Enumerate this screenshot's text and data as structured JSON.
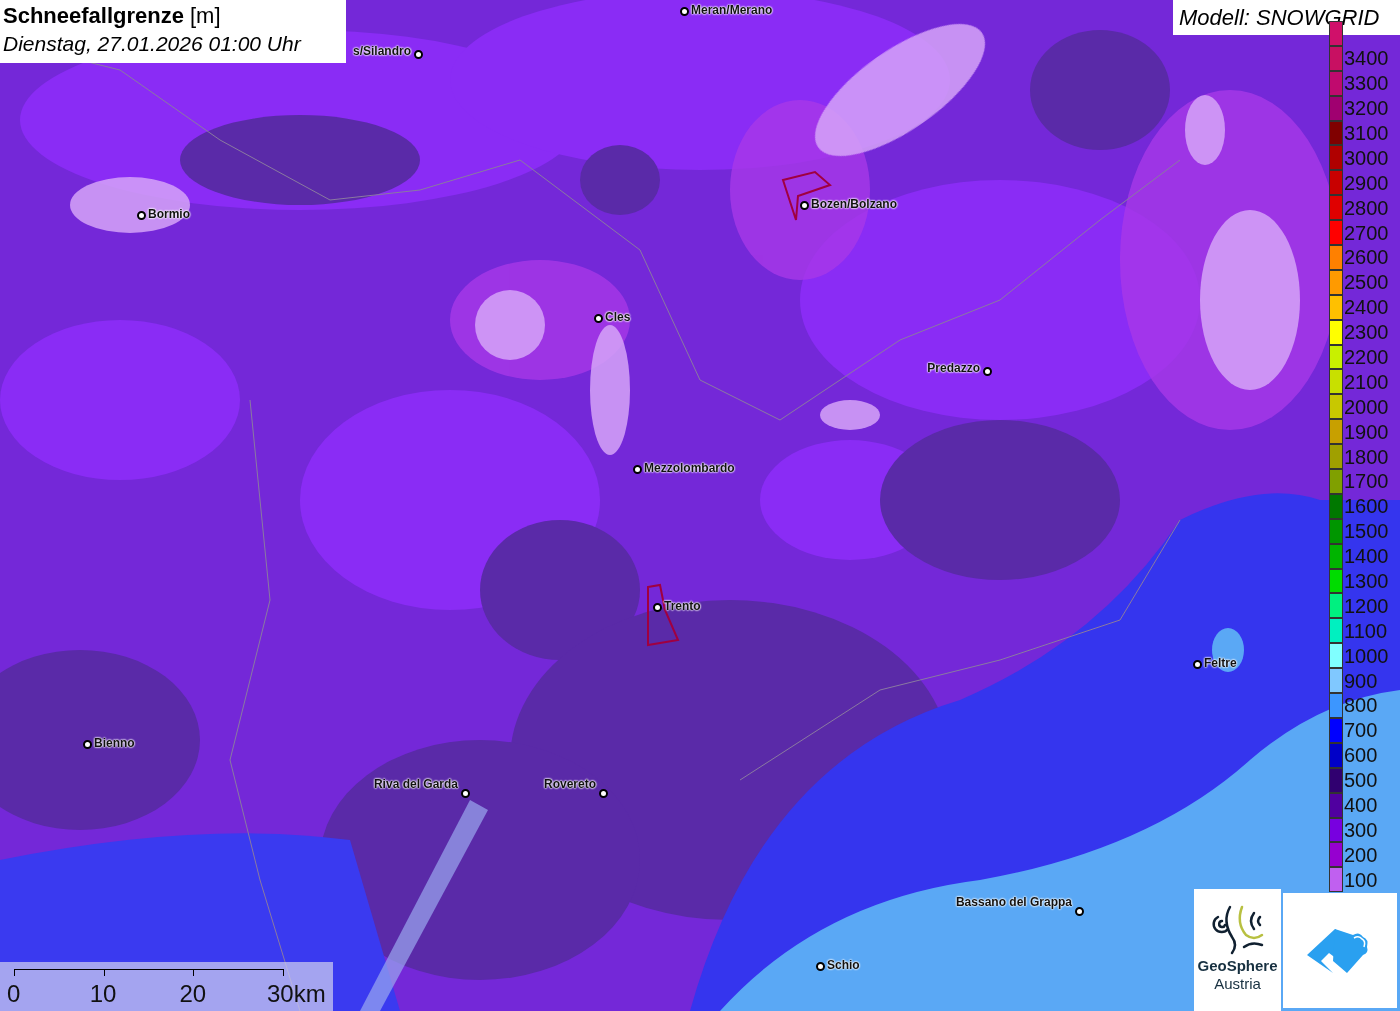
{
  "title": {
    "name": "Schneefallgrenze",
    "unit": "[m]",
    "datetime": "Dienstag, 27.01.2026 01:00 Uhr"
  },
  "model": "Modell: SNOWGRID",
  "places": [
    {
      "name": "Meran/Merano"
    },
    {
      "name": "s/Silandro"
    },
    {
      "name": "Bormio"
    },
    {
      "name": "Bozen/Bolzano"
    },
    {
      "name": "Cles"
    },
    {
      "name": "Predazzo"
    },
    {
      "name": "Mezzolombardo"
    },
    {
      "name": "Trento"
    },
    {
      "name": "Feltre"
    },
    {
      "name": "Bienno"
    },
    {
      "name": "Riva del Garda"
    },
    {
      "name": "Rovereto"
    },
    {
      "name": "Bassano del Grappa"
    },
    {
      "name": "Schio"
    }
  ],
  "legend": [
    {
      "color": "#d0106a"
    },
    {
      "label": "3400",
      "color": "#c81062"
    },
    {
      "label": "3300",
      "color": "#c00a6e"
    },
    {
      "label": "3200",
      "color": "#a00070"
    },
    {
      "label": "3100",
      "color": "#800000"
    },
    {
      "label": "3000",
      "color": "#b00000"
    },
    {
      "label": "2900",
      "color": "#c80000"
    },
    {
      "label": "2800",
      "color": "#e00000"
    },
    {
      "label": "2700",
      "color": "#ff0000"
    },
    {
      "label": "2600",
      "color": "#ff8000"
    },
    {
      "label": "2500",
      "color": "#ff9a00"
    },
    {
      "label": "2400",
      "color": "#ffc000"
    },
    {
      "label": "2300",
      "color": "#ffff00"
    },
    {
      "label": "2200",
      "color": "#c8f000"
    },
    {
      "label": "2100",
      "color": "#c8e000"
    },
    {
      "label": "2000",
      "color": "#c8c800"
    },
    {
      "label": "1900",
      "color": "#c8a000"
    },
    {
      "label": "1800",
      "color": "#a0a000"
    },
    {
      "label": "1700",
      "color": "#80a000"
    },
    {
      "label": "1600",
      "color": "#007800"
    },
    {
      "label": "1500",
      "color": "#009600"
    },
    {
      "label": "1400",
      "color": "#00b400"
    },
    {
      "label": "1300",
      "color": "#00dc00"
    },
    {
      "label": "1200",
      "color": "#00f080"
    },
    {
      "label": "1100",
      "color": "#00f0c0"
    },
    {
      "label": "1000",
      "color": "#80ffff"
    },
    {
      "label": "900",
      "color": "#80c8ff"
    },
    {
      "label": "800",
      "color": "#3c96ff"
    },
    {
      "label": "700",
      "color": "#0000ff"
    },
    {
      "label": "600",
      "color": "#0000c8"
    },
    {
      "label": "500",
      "color": "#300070"
    },
    {
      "label": "400",
      "color": "#5000a0"
    },
    {
      "label": "300",
      "color": "#7800e0"
    },
    {
      "label": "200",
      "color": "#9600d0"
    },
    {
      "label": "100",
      "color": "#c060f0"
    }
  ],
  "scale_bar": {
    "ticks": [
      "0",
      "10",
      "20",
      "30km"
    ]
  },
  "logo": {
    "line1": "GeoSphere",
    "line2": "Austria"
  }
}
